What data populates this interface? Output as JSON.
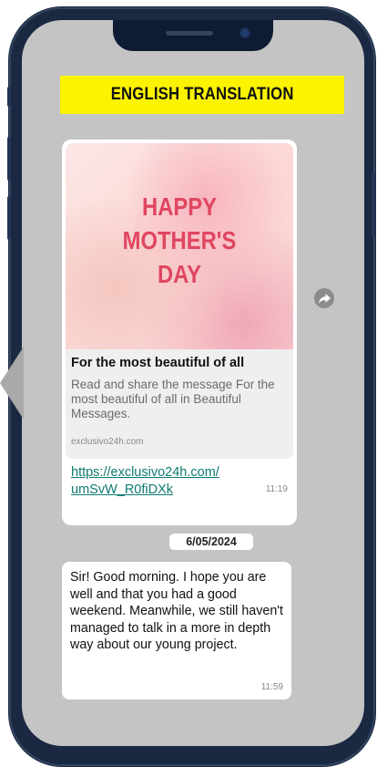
{
  "banner": {
    "text": "ENGLISH TRANSLATION",
    "color": "#fbf300"
  },
  "link_preview": {
    "image_lines": [
      "HAPPY",
      "MOTHER'S",
      "DAY"
    ],
    "title": "For the most beautiful of all",
    "description": "Read and share the message For the most beautiful of all in Beautiful Messages.",
    "domain": "exclusivo24h.com"
  },
  "message1": {
    "link_line1": "https://exclusivo24h.com/",
    "link_line2": "umSvW_R0fiDXk",
    "time": "11:19"
  },
  "date_divider": "6/05/2024",
  "message2": {
    "text": "Sir! Good morning. I hope you are well and that you had a good weekend. Meanwhile, we still haven't managed to talk in a more in depth way about our young project.",
    "time": "11:59"
  },
  "icons": {
    "share": "share-forward-icon"
  }
}
